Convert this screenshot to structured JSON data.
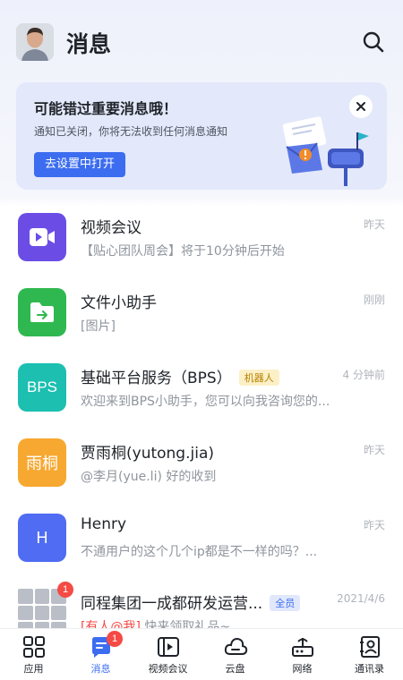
{
  "header": {
    "title": "消息",
    "avatar_icon": "user-avatar",
    "search_icon": "search-icon"
  },
  "notice": {
    "title": "可能错过重要消息哦！",
    "description": "通知已关闭，你将无法收到任何消息通知",
    "button_label": "去设置中打开",
    "close_icon": "close-icon",
    "illustration": "mailbox-illustration"
  },
  "chats": [
    {
      "name": "视频会议",
      "preview": "【贴心团队周会】将于10分钟后开始",
      "time": "昨天",
      "icon": "video-camera-icon",
      "color": "#6b4de6"
    },
    {
      "name": "文件小助手",
      "preview": "[图片]",
      "time": "刚刚",
      "icon": "folder-icon",
      "color": "#2fb84f"
    },
    {
      "name": "基础平台服务（BPS）",
      "tag": "机器人",
      "preview": "欢迎来到BPS小助手，您可以向我咨询您的...",
      "time": "4 分钟前",
      "avatar_text": "BPS",
      "color": "#1cbfb0"
    },
    {
      "name": "贾雨桐(yutong.jia)",
      "preview": "@李月(yue.li) 好的收到",
      "time": "昨天",
      "avatar_text": "雨桐",
      "color": "#f7a830"
    },
    {
      "name": "Henry",
      "preview": "不通用户的这个几个ip都是不一样的吗？...",
      "time": "昨天",
      "avatar_text": "H",
      "color": "#4f6cf2"
    },
    {
      "name": "同程集团一成都研发运营...",
      "tag": "全员",
      "preview_highlight": "[有人@我]",
      "preview": "快来领取礼品~",
      "time": "2021/4/6",
      "badge": "1"
    }
  ],
  "tabs": [
    {
      "label": "应用",
      "icon": "grid-apps-icon"
    },
    {
      "label": "消息",
      "icon": "message-icon",
      "badge": "1",
      "active": true
    },
    {
      "label": "视频会议",
      "icon": "video-meeting-icon"
    },
    {
      "label": "云盘",
      "icon": "cloud-icon"
    },
    {
      "label": "网络",
      "icon": "router-icon"
    },
    {
      "label": "通讯录",
      "icon": "contacts-icon"
    }
  ],
  "colors": {
    "accent": "#3c6df0",
    "badge": "#f54a45",
    "notice_bg": "#e3e8fa"
  }
}
